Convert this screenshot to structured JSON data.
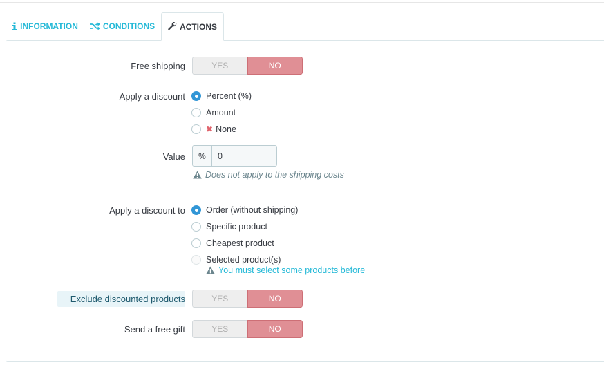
{
  "tabs": [
    {
      "label": "Information",
      "icon": "info-icon",
      "active": false
    },
    {
      "label": "Conditions",
      "icon": "shuffle-icon",
      "active": false
    },
    {
      "label": "Actions",
      "icon": "wrench-icon",
      "active": true
    }
  ],
  "form": {
    "free_shipping": {
      "label": "Free shipping",
      "yes": "YES",
      "no": "NO",
      "value": "NO"
    },
    "apply_discount": {
      "label": "Apply a discount",
      "options": [
        "Percent (%)",
        "Amount",
        "None"
      ],
      "selected": "Percent (%)"
    },
    "value": {
      "label": "Value",
      "addon": "%",
      "value": "0",
      "hint": "Does not apply to the shipping costs"
    },
    "apply_discount_to": {
      "label": "Apply a discount to",
      "options": [
        "Order (without shipping)",
        "Specific product",
        "Cheapest product",
        "Selected product(s)"
      ],
      "selected": "Order (without shipping)",
      "warning": "You must select some products before"
    },
    "exclude_discounted": {
      "label": "Exclude discounted products",
      "yes": "YES",
      "no": "NO",
      "value": "NO"
    },
    "free_gift": {
      "label": "Send a free gift",
      "yes": "YES",
      "no": "NO",
      "value": "NO"
    }
  },
  "colors": {
    "accent": "#25b9d7",
    "radio_on": "#3196d6",
    "no_on": "#e08f95",
    "danger": "#e0636c"
  }
}
